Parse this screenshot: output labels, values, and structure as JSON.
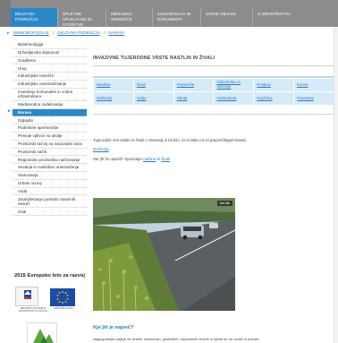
{
  "nav": {
    "tabs": [
      {
        "label": "DELOVNA PODROČJA"
      },
      {
        "label": "SPLETNE APLIKACIJE IN STORITVE"
      },
      {
        "label": "MEDIJSKO SREDIŠČE"
      },
      {
        "label": "ZAKONODAJA IN DOKUMENTI"
      },
      {
        "label": "JAVNE OBJAVE"
      },
      {
        "label": "O MINISTRSTVU"
      }
    ],
    "active_color": "#2b88c8",
    "bar_color": "#8c8c8c"
  },
  "breadcrumb": {
    "items": [
      "WWW.MOP.GOV.SI",
      "DELOVNA PODROČJA",
      "NARAVA"
    ],
    "separator": "/"
  },
  "sidebar": {
    "items": [
      {
        "label": "Biotehnologija"
      },
      {
        "label": "Državljanska dejavnost"
      },
      {
        "label": "Gradbeno"
      },
      {
        "label": "Hrup"
      },
      {
        "label": "Industrijske nesreče"
      },
      {
        "label": "Industrijsko onesnaževanje"
      },
      {
        "label": "Investicije komunalne in vodne infrastrukture"
      },
      {
        "label": "Mednarodno sodelovanje"
      },
      {
        "label": "Narava"
      },
      {
        "label": "Odpadki"
      },
      {
        "label": "Podnebne spremembe"
      },
      {
        "label": "Presoje vplivov na okolje"
      },
      {
        "label": "Prostorski razvoj na nacionalni ravni"
      },
      {
        "label": "Prostorski načrti"
      },
      {
        "label": "Regionalno prostorsko načrtovanje"
      },
      {
        "label": "Sevanja in svetlobno onesnaženje"
      },
      {
        "label": "Stanovanja"
      },
      {
        "label": "Urbani razvoj"
      },
      {
        "label": "Voda"
      },
      {
        "label": "Zmanjševanje posledic naravnih nesreč"
      },
      {
        "label": "Zrak"
      }
    ],
    "active_index": 8
  },
  "promo": {
    "title": "2015 Evropsko leto za razvoj",
    "seal_caption": "REPUBLIKA SLOVENIJA MINISTRSTVO ZA OKOLJE",
    "eu_caption": "EVROPSKA UNIJA"
  },
  "main": {
    "title": "INVAZIVNE TUJERODNE VRSTE RASTLIN IN ŽIVALI",
    "side_tag": "r",
    "categories_row1": [
      "Rastline",
      "Živali",
      "Preprečite",
      "Odstranitev in uničenje",
      "Predpisi",
      "Konca"
    ],
    "categories_row2": [
      "Definicija",
      "Vodje",
      "Izbrati",
      "Hortikultura",
      "Knjižnica",
      "Povezave"
    ],
    "paragraph1": "Tujerodnih vrst rastlin in živali v Sloveniji ni bil bilo, če ti lahko ne bi preprečiliegel Davek.",
    "definition_link": "Definicija",
    "paragraph3_prefix": "Ste jih že opazili? Spoznajte",
    "paragraph3_link1": "rastline",
    "paragraph3_mid": "in",
    "paragraph3_link2": "živali",
    "photo_tag": "Več slik",
    "subheading": "Kje jih je največ?",
    "paragraph4": "Naglogostejše najlejo ob cestah, železnicah, gradbiščih, zapuščenih vrtovih in njivah ter ob vodah in potokih."
  }
}
